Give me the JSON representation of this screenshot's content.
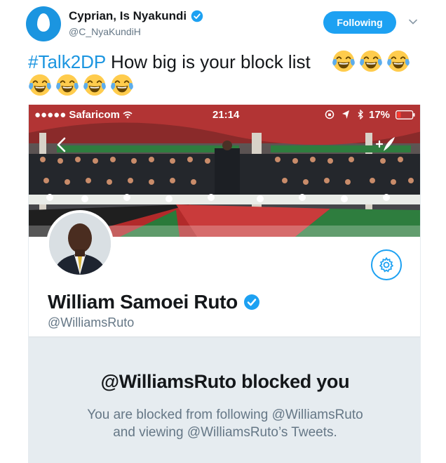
{
  "tweet": {
    "author_name": "Cyprian, Is Nyakundi",
    "author_handle": "@C_NyaKundiH",
    "follow_button_label": "Following",
    "hashtag": "#Talk2DP",
    "text": " How big is your block list",
    "emoji_count_line1": 3,
    "emoji_count_line2": 4,
    "emoji_name": "face-with-tears-of-joy-icon"
  },
  "screenshot": {
    "status_bar": {
      "carrier": "Safaricom",
      "time": "21:14",
      "battery": "17%"
    },
    "profile": {
      "name": "William Samoei Ruto",
      "handle": "@WilliamsRuto"
    },
    "blocked": {
      "title": "@WilliamsRuto blocked you",
      "line1": "You are blocked from following @WilliamsRuto",
      "line2": "and viewing @WilliamsRuto’s Tweets."
    }
  },
  "colors": {
    "accent": "#1da1f2",
    "hashtag": "#1b95e0",
    "panel": "#e6ecf0",
    "muted_text": "#657786"
  }
}
